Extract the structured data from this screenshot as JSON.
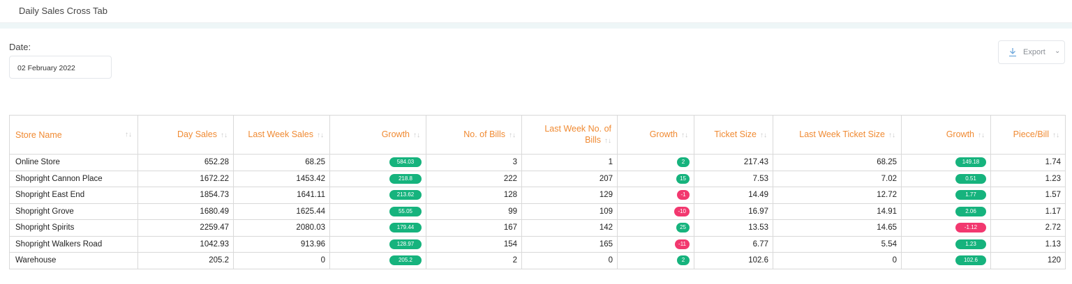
{
  "header": {
    "title": "Daily Sales Cross Tab"
  },
  "filters": {
    "date_label": "Date:",
    "date_value": "02 February 2022"
  },
  "toolbar": {
    "export_label": "Export"
  },
  "colors": {
    "accent": "#f08a32",
    "positive": "#16b37d",
    "negative": "#f2386f"
  },
  "table": {
    "columns": [
      "Store Name",
      "Day Sales",
      "Last Week Sales",
      "Growth",
      "No. of Bills",
      "Last Week No. of Bills",
      "Growth",
      "Ticket Size",
      "Last Week Ticket Size",
      "Growth",
      "Piece/Bill"
    ],
    "rows": [
      {
        "store": "Online Store",
        "day_sales": "652.28",
        "lw_sales": "68.25",
        "sales_growth": "584.03",
        "bills": "3",
        "lw_bills": "1",
        "bills_growth": "2",
        "ticket": "217.43",
        "lw_ticket": "68.25",
        "ticket_growth": "149.18",
        "piece_bill": "1.74"
      },
      {
        "store": "Shopright Cannon Place",
        "day_sales": "1672.22",
        "lw_sales": "1453.42",
        "sales_growth": "218.8",
        "bills": "222",
        "lw_bills": "207",
        "bills_growth": "15",
        "ticket": "7.53",
        "lw_ticket": "7.02",
        "ticket_growth": "0.51",
        "piece_bill": "1.23"
      },
      {
        "store": "Shopright East End",
        "day_sales": "1854.73",
        "lw_sales": "1641.11",
        "sales_growth": "213.62",
        "bills": "128",
        "lw_bills": "129",
        "bills_growth": "-1",
        "ticket": "14.49",
        "lw_ticket": "12.72",
        "ticket_growth": "1.77",
        "piece_bill": "1.57"
      },
      {
        "store": "Shopright Grove",
        "day_sales": "1680.49",
        "lw_sales": "1625.44",
        "sales_growth": "55.05",
        "bills": "99",
        "lw_bills": "109",
        "bills_growth": "-10",
        "ticket": "16.97",
        "lw_ticket": "14.91",
        "ticket_growth": "2.06",
        "piece_bill": "1.17"
      },
      {
        "store": "Shopright Spirits",
        "day_sales": "2259.47",
        "lw_sales": "2080.03",
        "sales_growth": "179.44",
        "bills": "167",
        "lw_bills": "142",
        "bills_growth": "25",
        "ticket": "13.53",
        "lw_ticket": "14.65",
        "ticket_growth": "-1.12",
        "piece_bill": "2.72"
      },
      {
        "store": "Shopright Walkers Road",
        "day_sales": "1042.93",
        "lw_sales": "913.96",
        "sales_growth": "128.97",
        "bills": "154",
        "lw_bills": "165",
        "bills_growth": "-11",
        "ticket": "6.77",
        "lw_ticket": "5.54",
        "ticket_growth": "1.23",
        "piece_bill": "1.13"
      },
      {
        "store": "Warehouse",
        "day_sales": "205.2",
        "lw_sales": "0",
        "sales_growth": "205.2",
        "bills": "2",
        "lw_bills": "0",
        "bills_growth": "2",
        "ticket": "102.6",
        "lw_ticket": "0",
        "ticket_growth": "102.6",
        "piece_bill": "120"
      }
    ]
  }
}
